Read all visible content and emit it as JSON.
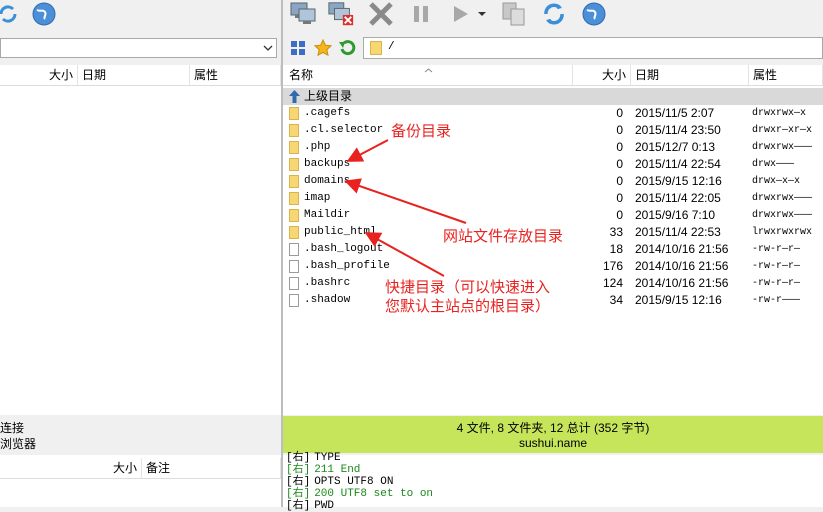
{
  "toolbar": {
    "icons": [
      "refresh-icon",
      "globe-icon",
      "connect-icon",
      "disconnect-icon",
      "stop-icon",
      "pause-icon",
      "play-icon",
      "dropdown-arrow-icon",
      "sync-icon",
      "refresh-icon",
      "globe-icon"
    ]
  },
  "remote_path": {
    "value": "/"
  },
  "local_columns": {
    "size": "大小",
    "date": "日期",
    "attr": "属性"
  },
  "remote_columns": {
    "name": "名称",
    "size": "大小",
    "date": "日期",
    "attr": "属性"
  },
  "parent_row": {
    "label": "上级目录"
  },
  "files": [
    {
      "name": ".cagefs",
      "type": "folder",
      "size": "0",
      "date": "2015/11/5 2:07",
      "attr": "drwxrwx—x"
    },
    {
      "name": ".cl.selector",
      "type": "folder",
      "size": "0",
      "date": "2015/11/4 23:50",
      "attr": "drwxr—xr—x"
    },
    {
      "name": ".php",
      "type": "folder",
      "size": "0",
      "date": "2015/12/7 0:13",
      "attr": "drwxrwx———"
    },
    {
      "name": "backups",
      "type": "folder",
      "size": "0",
      "date": "2015/11/4 22:54",
      "attr": "drwx———"
    },
    {
      "name": "domains",
      "type": "folder",
      "size": "0",
      "date": "2015/9/15 12:16",
      "attr": "drwx—x—x"
    },
    {
      "name": "imap",
      "type": "folder",
      "size": "0",
      "date": "2015/11/4 22:05",
      "attr": "drwxrwx———"
    },
    {
      "name": "Maildir",
      "type": "folder",
      "size": "0",
      "date": "2015/9/16 7:10",
      "attr": "drwxrwx———"
    },
    {
      "name": "public_html",
      "type": "link",
      "size": "33",
      "date": "2015/11/4 22:53",
      "attr": "lrwxrwxrwx"
    },
    {
      "name": ".bash_logout",
      "type": "file",
      "size": "18",
      "date": "2014/10/16 21:56",
      "attr": "-rw-r—r—"
    },
    {
      "name": ".bash_profile",
      "type": "file",
      "size": "176",
      "date": "2014/10/16 21:56",
      "attr": "-rw-r—r—"
    },
    {
      "name": ".bashrc",
      "type": "file",
      "size": "124",
      "date": "2014/10/16 21:56",
      "attr": "-rw-r—r—"
    },
    {
      "name": ".shadow",
      "type": "file",
      "size": "34",
      "date": "2015/9/15 12:16",
      "attr": "-rw-r———"
    }
  ],
  "annotations": {
    "backup": "备份目录",
    "website": "网站文件存放目录",
    "shortcut_line1": "快捷目录（可以快速进入",
    "shortcut_line2": "您默认主站点的根目录）"
  },
  "left_bottom": {
    "connect": "连接",
    "browser": "浏览器"
  },
  "status": {
    "summary": "4 文件, 8 文件夹, 12 总计 (352 字节)",
    "host": "sushui.name"
  },
  "queue_columns": {
    "size": "大小",
    "note": "备注"
  },
  "log": [
    {
      "tag": "[右]",
      "text": "TYPE",
      "color": "#000000"
    },
    {
      "tag": "[右]",
      "text": "211 End",
      "color": "#1a8a1a"
    },
    {
      "tag": "[右]",
      "text": "OPTS UTF8 ON",
      "color": "#000000"
    },
    {
      "tag": "[右]",
      "text": "200 UTF8 set to on",
      "color": "#1a8a1a"
    },
    {
      "tag": "[右]",
      "text": "PWD",
      "color": "#000000"
    }
  ],
  "colors": {
    "status_bg": "#c7e55a",
    "annotation": "#e8231f",
    "log_ok": "#1a8a1a"
  }
}
